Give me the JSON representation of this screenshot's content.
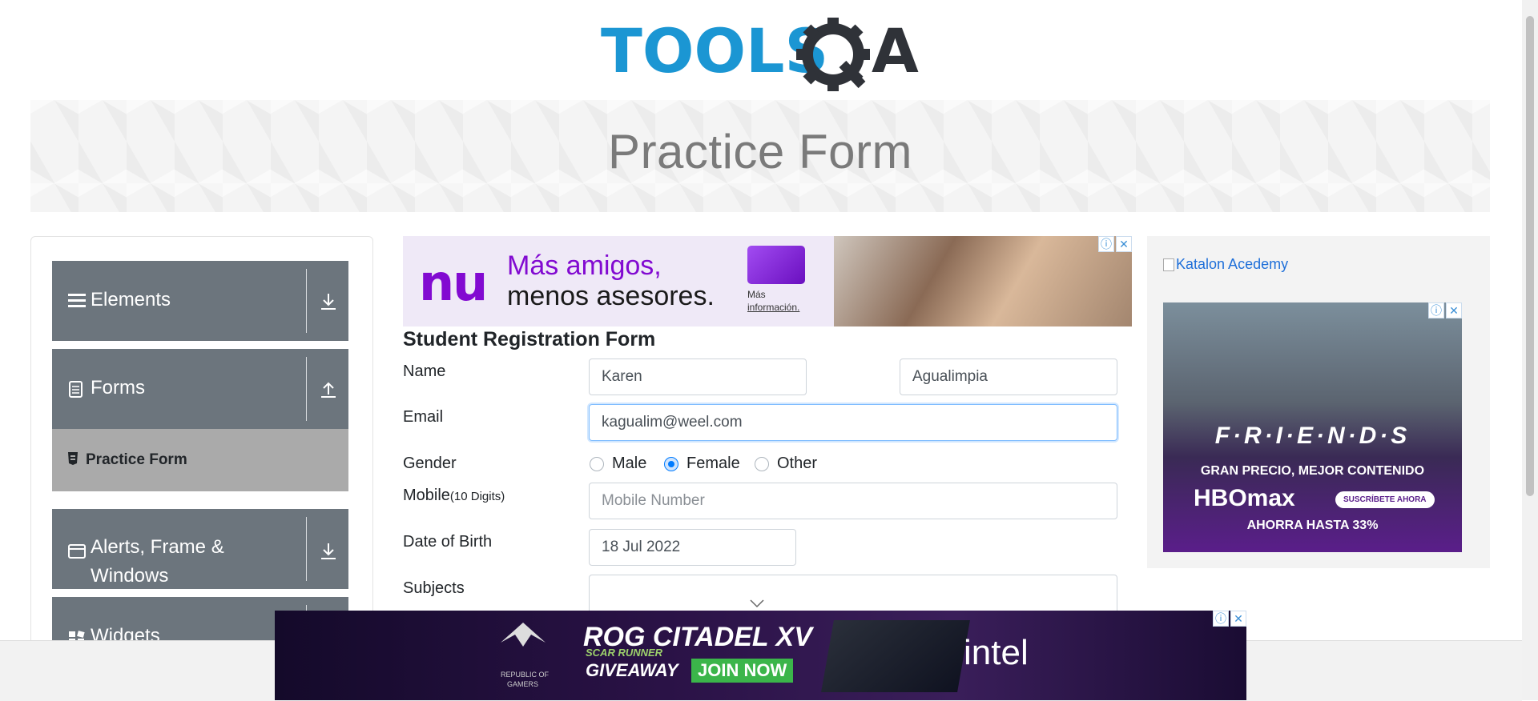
{
  "logo": {
    "text_blue": "TOOLS",
    "text_dark": "A"
  },
  "banner": {
    "title": "Practice Form"
  },
  "sidebar": {
    "groups": [
      {
        "label": "Elements"
      },
      {
        "label": "Forms"
      },
      {
        "label": "Alerts, Frame &",
        "label2": "Windows"
      },
      {
        "label": "Widgets"
      }
    ],
    "active_item": "Practice Form"
  },
  "ads": {
    "top": {
      "brand": "nu",
      "line1": "Más amigos,",
      "line2": "menos asesores.",
      "cta1": "Más",
      "cta2": "información."
    },
    "right": {
      "broken_image_alt": "Katalon Acedemy",
      "show": "F·R·I·E·N·D·S",
      "line1": "GRAN PRECIO, MEJOR CONTENIDO",
      "brand": "HBOmax",
      "cta": "SUSCRÍBETE AHORA",
      "line2": "AHORRA HASTA 33%"
    },
    "bottom": {
      "sub1": "REPUBLIC OF",
      "sub2": "GAMERS",
      "title": "ROG CITADEL XV",
      "subtitle": "SCAR RUNNER",
      "giveaway": "GIVEAWAY",
      "cta": "JOIN NOW",
      "partner": "intel"
    },
    "info_glyph": "ⓘ",
    "close_glyph": "✕"
  },
  "form": {
    "title": "Student Registration Form",
    "name_label": "Name",
    "first_name": "Karen",
    "last_name": "Agualimpia",
    "email_label": "Email",
    "email": "kagualim@weel.com",
    "gender_label": "Gender",
    "gender_options": [
      "Male",
      "Female",
      "Other"
    ],
    "gender_selected": "Female",
    "mobile_label": "Mobile",
    "mobile_hint": "(10 Digits)",
    "mobile_placeholder": "Mobile Number",
    "dob_label": "Date of Birth",
    "dob": "18 Jul 2022",
    "subjects_label": "Subjects"
  }
}
